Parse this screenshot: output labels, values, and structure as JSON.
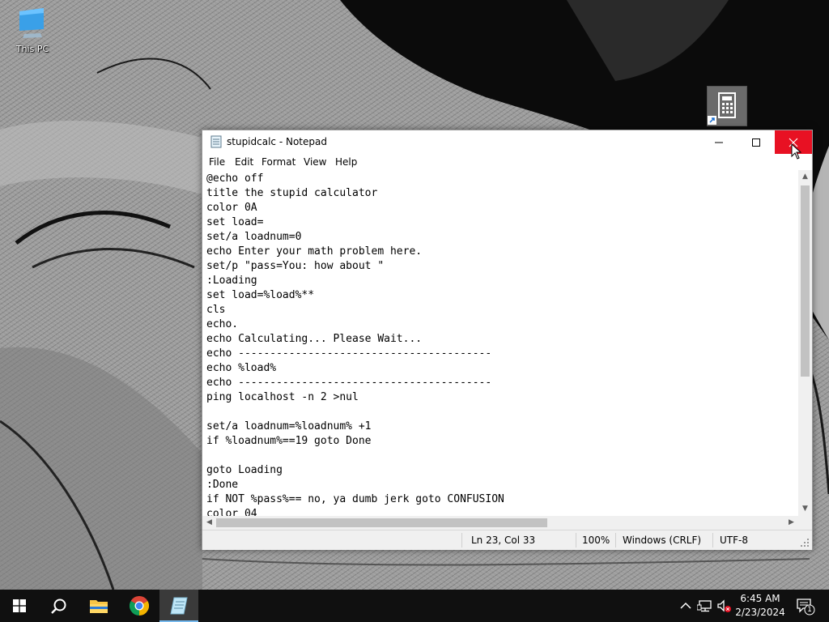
{
  "desktop": {
    "icons": [
      {
        "label": "This PC",
        "icon": "this-pc-icon"
      }
    ],
    "shortcut": {
      "icon": "calculator-icon"
    }
  },
  "window": {
    "title": "stupidcalc - Notepad",
    "menu": [
      "File",
      "Edit",
      "Format",
      "View",
      "Help"
    ],
    "lines": [
      "@echo off",
      "title the stupid calculator",
      "color 0A",
      "set load=",
      "set/a loadnum=0",
      "echo Enter your math problem here.",
      "set/p \"pass=You: how about \"",
      ":Loading",
      "set load=%load%**",
      "cls",
      "echo.",
      "echo Calculating... Please Wait...",
      "echo ----------------------------------------",
      "echo %load%",
      "echo ----------------------------------------",
      "ping localhost -n 2 >nul",
      "",
      "set/a loadnum=%loadnum% +1",
      "if %loadnum%==19 goto Done",
      "",
      "goto Loading",
      ":Done",
      "if NOT %pass%== no, ya dumb jerk goto CONFUSION",
      "color 04"
    ],
    "status": {
      "position": "Ln 23, Col 33",
      "zoom": "100%",
      "line_ending": "Windows (CRLF)",
      "encoding": "UTF-8"
    }
  },
  "taskbar": {
    "time": "6:45 AM",
    "date": "2/23/2024",
    "notifications": "1",
    "accent": "#76b9ed"
  }
}
